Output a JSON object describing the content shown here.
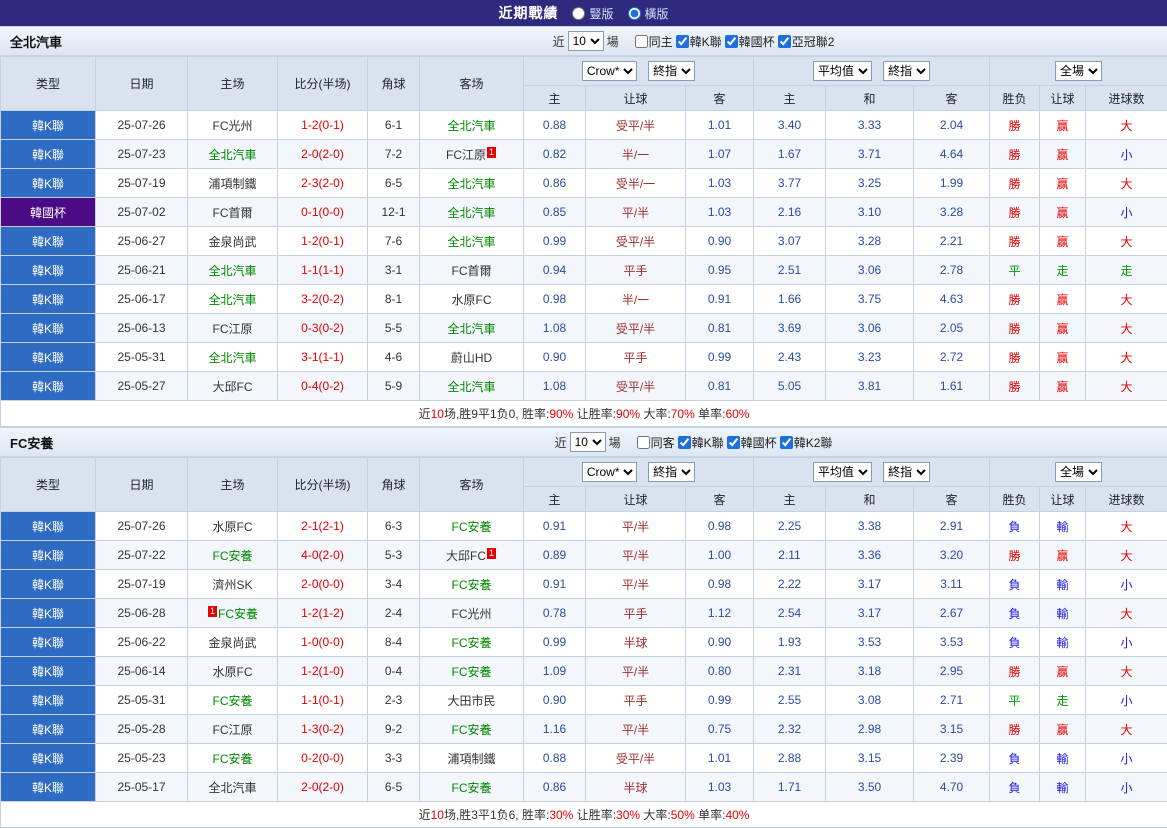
{
  "topbar": {
    "title": "近期戰績",
    "vertical_label": "豎版",
    "horizontal_label": "橫版",
    "vertical_checked": false,
    "horizontal_checked": true
  },
  "columns": {
    "type": "类型",
    "date": "日期",
    "home": "主场",
    "score": "比分(半场)",
    "corner": "角球",
    "away": "客场",
    "ah_home": "主",
    "ah_line": "让球",
    "ah_away": "客",
    "eu_home": "主",
    "eu_draw": "和",
    "eu_away": "客",
    "result": "胜负",
    "handicap": "让球",
    "goals": "进球数"
  },
  "controls": {
    "company": "Crow*",
    "final": "終指",
    "avg": "平均值",
    "final2": "終指",
    "scope": "全場"
  },
  "colors": {
    "topbar_bg": "#2f2a7d",
    "league_blue": "#2e6cc3",
    "cup_purple": "#4c0b86",
    "win_red": "#e60000",
    "draw_green": "#009900",
    "lose_blue": "#1a1ae6",
    "self_green": "#008800"
  },
  "sections": [
    {
      "team": "全北汽車",
      "filter": {
        "near": "近",
        "count": "10",
        "games": "場",
        "same": {
          "label": "同主",
          "checked": false
        },
        "leagues": [
          {
            "label": "韓K聯",
            "checked": true
          },
          {
            "label": "韓國杯",
            "checked": true
          },
          {
            "label": "亞冠聯2",
            "checked": true
          }
        ]
      },
      "rows": [
        {
          "league": "韓K聯",
          "cup": false,
          "date": "25-07-26",
          "home": {
            "name": "FC光州",
            "green": false
          },
          "score": "1-2(0-1)",
          "corner": "6-1",
          "away": {
            "name": "全北汽車",
            "green": true
          },
          "ah": {
            "home": "0.88",
            "line": "受平/半",
            "away": "1.01"
          },
          "eu": {
            "home": "3.40",
            "draw": "3.33",
            "away": "2.04"
          },
          "outcome": {
            "result": "勝",
            "result_color": "r",
            "handicap": "赢",
            "handicap_color": "r",
            "goals": "大",
            "goals_color": "r"
          }
        },
        {
          "league": "韓K聯",
          "cup": false,
          "date": "25-07-23",
          "home": {
            "name": "全北汽車",
            "green": true
          },
          "score": "2-0(2-0)",
          "corner": "7-2",
          "away": {
            "name": "FC江原",
            "green": false,
            "badge_after": "1"
          },
          "ah": {
            "home": "0.82",
            "line": "半/一",
            "away": "1.07"
          },
          "eu": {
            "home": "1.67",
            "draw": "3.71",
            "away": "4.64"
          },
          "outcome": {
            "result": "勝",
            "result_color": "r",
            "handicap": "赢",
            "handicap_color": "r",
            "goals": "小",
            "goals_color": "b"
          }
        },
        {
          "league": "韓K聯",
          "cup": false,
          "date": "25-07-19",
          "home": {
            "name": "浦項制鐵",
            "green": false
          },
          "score": "2-3(2-0)",
          "corner": "6-5",
          "away": {
            "name": "全北汽車",
            "green": true
          },
          "ah": {
            "home": "0.86",
            "line": "受半/一",
            "away": "1.03"
          },
          "eu": {
            "home": "3.77",
            "draw": "3.25",
            "away": "1.99"
          },
          "outcome": {
            "result": "勝",
            "result_color": "r",
            "handicap": "赢",
            "handicap_color": "r",
            "goals": "大",
            "goals_color": "r"
          }
        },
        {
          "league": "韓國杯",
          "cup": true,
          "date": "25-07-02",
          "home": {
            "name": "FC首爾",
            "green": false
          },
          "score": "0-1(0-0)",
          "corner": "12-1",
          "away": {
            "name": "全北汽車",
            "green": true
          },
          "ah": {
            "home": "0.85",
            "line": "平/半",
            "away": "1.03"
          },
          "eu": {
            "home": "2.16",
            "draw": "3.10",
            "away": "3.28"
          },
          "outcome": {
            "result": "勝",
            "result_color": "r",
            "handicap": "赢",
            "handicap_color": "r",
            "goals": "小",
            "goals_color": "b"
          }
        },
        {
          "league": "韓K聯",
          "cup": false,
          "date": "25-06-27",
          "home": {
            "name": "金泉尚武",
            "green": false
          },
          "score": "1-2(0-1)",
          "corner": "7-6",
          "away": {
            "name": "全北汽車",
            "green": true
          },
          "ah": {
            "home": "0.99",
            "line": "受平/半",
            "away": "0.90"
          },
          "eu": {
            "home": "3.07",
            "draw": "3.28",
            "away": "2.21"
          },
          "outcome": {
            "result": "勝",
            "result_color": "r",
            "handicap": "赢",
            "handicap_color": "r",
            "goals": "大",
            "goals_color": "r"
          }
        },
        {
          "league": "韓K聯",
          "cup": false,
          "date": "25-06-21",
          "home": {
            "name": "全北汽車",
            "green": true
          },
          "score": "1-1(1-1)",
          "corner": "3-1",
          "away": {
            "name": "FC首爾",
            "green": false
          },
          "ah": {
            "home": "0.94",
            "line": "平手",
            "away": "0.95"
          },
          "eu": {
            "home": "2.51",
            "draw": "3.06",
            "away": "2.78"
          },
          "outcome": {
            "result": "平",
            "result_color": "g",
            "handicap": "走",
            "handicap_color": "g",
            "goals": "走",
            "goals_color": "g"
          }
        },
        {
          "league": "韓K聯",
          "cup": false,
          "date": "25-06-17",
          "home": {
            "name": "全北汽車",
            "green": true
          },
          "score": "3-2(0-2)",
          "corner": "8-1",
          "away": {
            "name": "水原FC",
            "green": false
          },
          "ah": {
            "home": "0.98",
            "line": "半/一",
            "away": "0.91"
          },
          "eu": {
            "home": "1.66",
            "draw": "3.75",
            "away": "4.63"
          },
          "outcome": {
            "result": "勝",
            "result_color": "r",
            "handicap": "赢",
            "handicap_color": "r",
            "goals": "大",
            "goals_color": "r"
          }
        },
        {
          "league": "韓K聯",
          "cup": false,
          "date": "25-06-13",
          "home": {
            "name": "FC江原",
            "green": false
          },
          "score": "0-3(0-2)",
          "corner": "5-5",
          "away": {
            "name": "全北汽車",
            "green": true
          },
          "ah": {
            "home": "1.08",
            "line": "受平/半",
            "away": "0.81"
          },
          "eu": {
            "home": "3.69",
            "draw": "3.06",
            "away": "2.05"
          },
          "outcome": {
            "result": "勝",
            "result_color": "r",
            "handicap": "赢",
            "handicap_color": "r",
            "goals": "大",
            "goals_color": "r"
          }
        },
        {
          "league": "韓K聯",
          "cup": false,
          "date": "25-05-31",
          "home": {
            "name": "全北汽車",
            "green": true
          },
          "score": "3-1(1-1)",
          "corner": "4-6",
          "away": {
            "name": "蔚山HD",
            "green": false
          },
          "ah": {
            "home": "0.90",
            "line": "平手",
            "away": "0.99"
          },
          "eu": {
            "home": "2.43",
            "draw": "3.23",
            "away": "2.72"
          },
          "outcome": {
            "result": "勝",
            "result_color": "r",
            "handicap": "赢",
            "handicap_color": "r",
            "goals": "大",
            "goals_color": "r"
          }
        },
        {
          "league": "韓K聯",
          "cup": false,
          "date": "25-05-27",
          "home": {
            "name": "大邱FC",
            "green": false
          },
          "score": "0-4(0-2)",
          "corner": "5-9",
          "away": {
            "name": "全北汽車",
            "green": true
          },
          "ah": {
            "home": "1.08",
            "line": "受平/半",
            "away": "0.81"
          },
          "eu": {
            "home": "5.05",
            "draw": "3.81",
            "away": "1.61"
          },
          "outcome": {
            "result": "勝",
            "result_color": "r",
            "handicap": "赢",
            "handicap_color": "r",
            "goals": "大",
            "goals_color": "r"
          }
        }
      ],
      "summary": [
        {
          "t": "近",
          "c": "k"
        },
        {
          "t": "10",
          "c": "r"
        },
        {
          "t": "场,胜9平1负0, ",
          "c": "k"
        },
        {
          "t": "胜率:",
          "c": "k"
        },
        {
          "t": "90%",
          "c": "r"
        },
        {
          "t": " 让胜率:",
          "c": "k"
        },
        {
          "t": "90%",
          "c": "r"
        },
        {
          "t": " 大率:",
          "c": "k"
        },
        {
          "t": "70%",
          "c": "r"
        },
        {
          "t": " 单率:",
          "c": "k"
        },
        {
          "t": "60%",
          "c": "r"
        }
      ]
    },
    {
      "team": "FC安養",
      "filter": {
        "near": "近",
        "count": "10",
        "games": "場",
        "same": {
          "label": "同客",
          "checked": false
        },
        "leagues": [
          {
            "label": "韓K聯",
            "checked": true
          },
          {
            "label": "韓國杯",
            "checked": true
          },
          {
            "label": "韓K2聯",
            "checked": true
          }
        ]
      },
      "rows": [
        {
          "league": "韓K聯",
          "cup": false,
          "date": "25-07-26",
          "home": {
            "name": "水原FC",
            "green": false
          },
          "score": "2-1(2-1)",
          "corner": "6-3",
          "away": {
            "name": "FC安養",
            "green": true
          },
          "ah": {
            "home": "0.91",
            "line": "平/半",
            "away": "0.98"
          },
          "eu": {
            "home": "2.25",
            "draw": "3.38",
            "away": "2.91"
          },
          "outcome": {
            "result": "負",
            "result_color": "b",
            "handicap": "輸",
            "handicap_color": "b",
            "goals": "大",
            "goals_color": "r"
          }
        },
        {
          "league": "韓K聯",
          "cup": false,
          "date": "25-07-22",
          "home": {
            "name": "FC安養",
            "green": true
          },
          "score": "4-0(2-0)",
          "corner": "5-3",
          "away": {
            "name": "大邱FC",
            "green": false,
            "badge_after": "1"
          },
          "ah": {
            "home": "0.89",
            "line": "平/半",
            "away": "1.00"
          },
          "eu": {
            "home": "2.11",
            "draw": "3.36",
            "away": "3.20"
          },
          "outcome": {
            "result": "勝",
            "result_color": "r",
            "handicap": "赢",
            "handicap_color": "r",
            "goals": "大",
            "goals_color": "r"
          }
        },
        {
          "league": "韓K聯",
          "cup": false,
          "date": "25-07-19",
          "home": {
            "name": "濟州SK",
            "green": false
          },
          "score": "2-0(0-0)",
          "corner": "3-4",
          "away": {
            "name": "FC安養",
            "green": true
          },
          "ah": {
            "home": "0.91",
            "line": "平/半",
            "away": "0.98"
          },
          "eu": {
            "home": "2.22",
            "draw": "3.17",
            "away": "3.11"
          },
          "outcome": {
            "result": "負",
            "result_color": "b",
            "handicap": "輸",
            "handicap_color": "b",
            "goals": "小",
            "goals_color": "b"
          }
        },
        {
          "league": "韓K聯",
          "cup": false,
          "date": "25-06-28",
          "home": {
            "name": "FC安養",
            "green": true,
            "badge_before": "1"
          },
          "score": "1-2(1-2)",
          "corner": "2-4",
          "away": {
            "name": "FC光州",
            "green": false
          },
          "ah": {
            "home": "0.78",
            "line": "平手",
            "away": "1.12"
          },
          "eu": {
            "home": "2.54",
            "draw": "3.17",
            "away": "2.67"
          },
          "outcome": {
            "result": "負",
            "result_color": "b",
            "handicap": "輸",
            "handicap_color": "b",
            "goals": "大",
            "goals_color": "r"
          }
        },
        {
          "league": "韓K聯",
          "cup": false,
          "date": "25-06-22",
          "home": {
            "name": "金泉尚武",
            "green": false
          },
          "score": "1-0(0-0)",
          "corner": "8-4",
          "away": {
            "name": "FC安養",
            "green": true
          },
          "ah": {
            "home": "0.99",
            "line": "半球",
            "away": "0.90"
          },
          "eu": {
            "home": "1.93",
            "draw": "3.53",
            "away": "3.53"
          },
          "outcome": {
            "result": "負",
            "result_color": "b",
            "handicap": "輸",
            "handicap_color": "b",
            "goals": "小",
            "goals_color": "b"
          }
        },
        {
          "league": "韓K聯",
          "cup": false,
          "date": "25-06-14",
          "home": {
            "name": "水原FC",
            "green": false
          },
          "score": "1-2(1-0)",
          "corner": "0-4",
          "away": {
            "name": "FC安養",
            "green": true
          },
          "ah": {
            "home": "1.09",
            "line": "平/半",
            "away": "0.80"
          },
          "eu": {
            "home": "2.31",
            "draw": "3.18",
            "away": "2.95"
          },
          "outcome": {
            "result": "勝",
            "result_color": "r",
            "handicap": "赢",
            "handicap_color": "r",
            "goals": "大",
            "goals_color": "r"
          }
        },
        {
          "league": "韓K聯",
          "cup": false,
          "date": "25-05-31",
          "home": {
            "name": "FC安養",
            "green": true
          },
          "score": "1-1(0-1)",
          "corner": "2-3",
          "away": {
            "name": "大田市民",
            "green": false
          },
          "ah": {
            "home": "0.90",
            "line": "平手",
            "away": "0.99"
          },
          "eu": {
            "home": "2.55",
            "draw": "3.08",
            "away": "2.71"
          },
          "outcome": {
            "result": "平",
            "result_color": "g",
            "handicap": "走",
            "handicap_color": "g",
            "goals": "小",
            "goals_color": "b"
          }
        },
        {
          "league": "韓K聯",
          "cup": false,
          "date": "25-05-28",
          "home": {
            "name": "FC江原",
            "green": false
          },
          "score": "1-3(0-2)",
          "corner": "9-2",
          "away": {
            "name": "FC安養",
            "green": true
          },
          "ah": {
            "home": "1.16",
            "line": "平/半",
            "away": "0.75"
          },
          "eu": {
            "home": "2.32",
            "draw": "2.98",
            "away": "3.15"
          },
          "outcome": {
            "result": "勝",
            "result_color": "r",
            "handicap": "赢",
            "handicap_color": "r",
            "goals": "大",
            "goals_color": "r"
          }
        },
        {
          "league": "韓K聯",
          "cup": false,
          "date": "25-05-23",
          "home": {
            "name": "FC安養",
            "green": true
          },
          "score": "0-2(0-0)",
          "corner": "3-3",
          "away": {
            "name": "浦項制鐵",
            "green": false
          },
          "ah": {
            "home": "0.88",
            "line": "受平/半",
            "away": "1.01"
          },
          "eu": {
            "home": "2.88",
            "draw": "3.15",
            "away": "2.39"
          },
          "outcome": {
            "result": "負",
            "result_color": "b",
            "handicap": "輸",
            "handicap_color": "b",
            "goals": "小",
            "goals_color": "b"
          }
        },
        {
          "league": "韓K聯",
          "cup": false,
          "date": "25-05-17",
          "home": {
            "name": "全北汽車",
            "green": false
          },
          "score": "2-0(2-0)",
          "corner": "6-5",
          "away": {
            "name": "FC安養",
            "green": true
          },
          "ah": {
            "home": "0.86",
            "line": "半球",
            "away": "1.03"
          },
          "eu": {
            "home": "1.71",
            "draw": "3.50",
            "away": "4.70"
          },
          "outcome": {
            "result": "負",
            "result_color": "b",
            "handicap": "輸",
            "handicap_color": "b",
            "goals": "小",
            "goals_color": "b"
          }
        }
      ],
      "summary": [
        {
          "t": "近",
          "c": "k"
        },
        {
          "t": "10",
          "c": "r"
        },
        {
          "t": "场,胜3平1负6, ",
          "c": "k"
        },
        {
          "t": "胜率:",
          "c": "k"
        },
        {
          "t": "30%",
          "c": "r"
        },
        {
          "t": " 让胜率:",
          "c": "k"
        },
        {
          "t": "30%",
          "c": "r"
        },
        {
          "t": " 大率:",
          "c": "k"
        },
        {
          "t": "50%",
          "c": "r"
        },
        {
          "t": " 单率:",
          "c": "k"
        },
        {
          "t": "40%",
          "c": "r"
        }
      ]
    }
  ]
}
